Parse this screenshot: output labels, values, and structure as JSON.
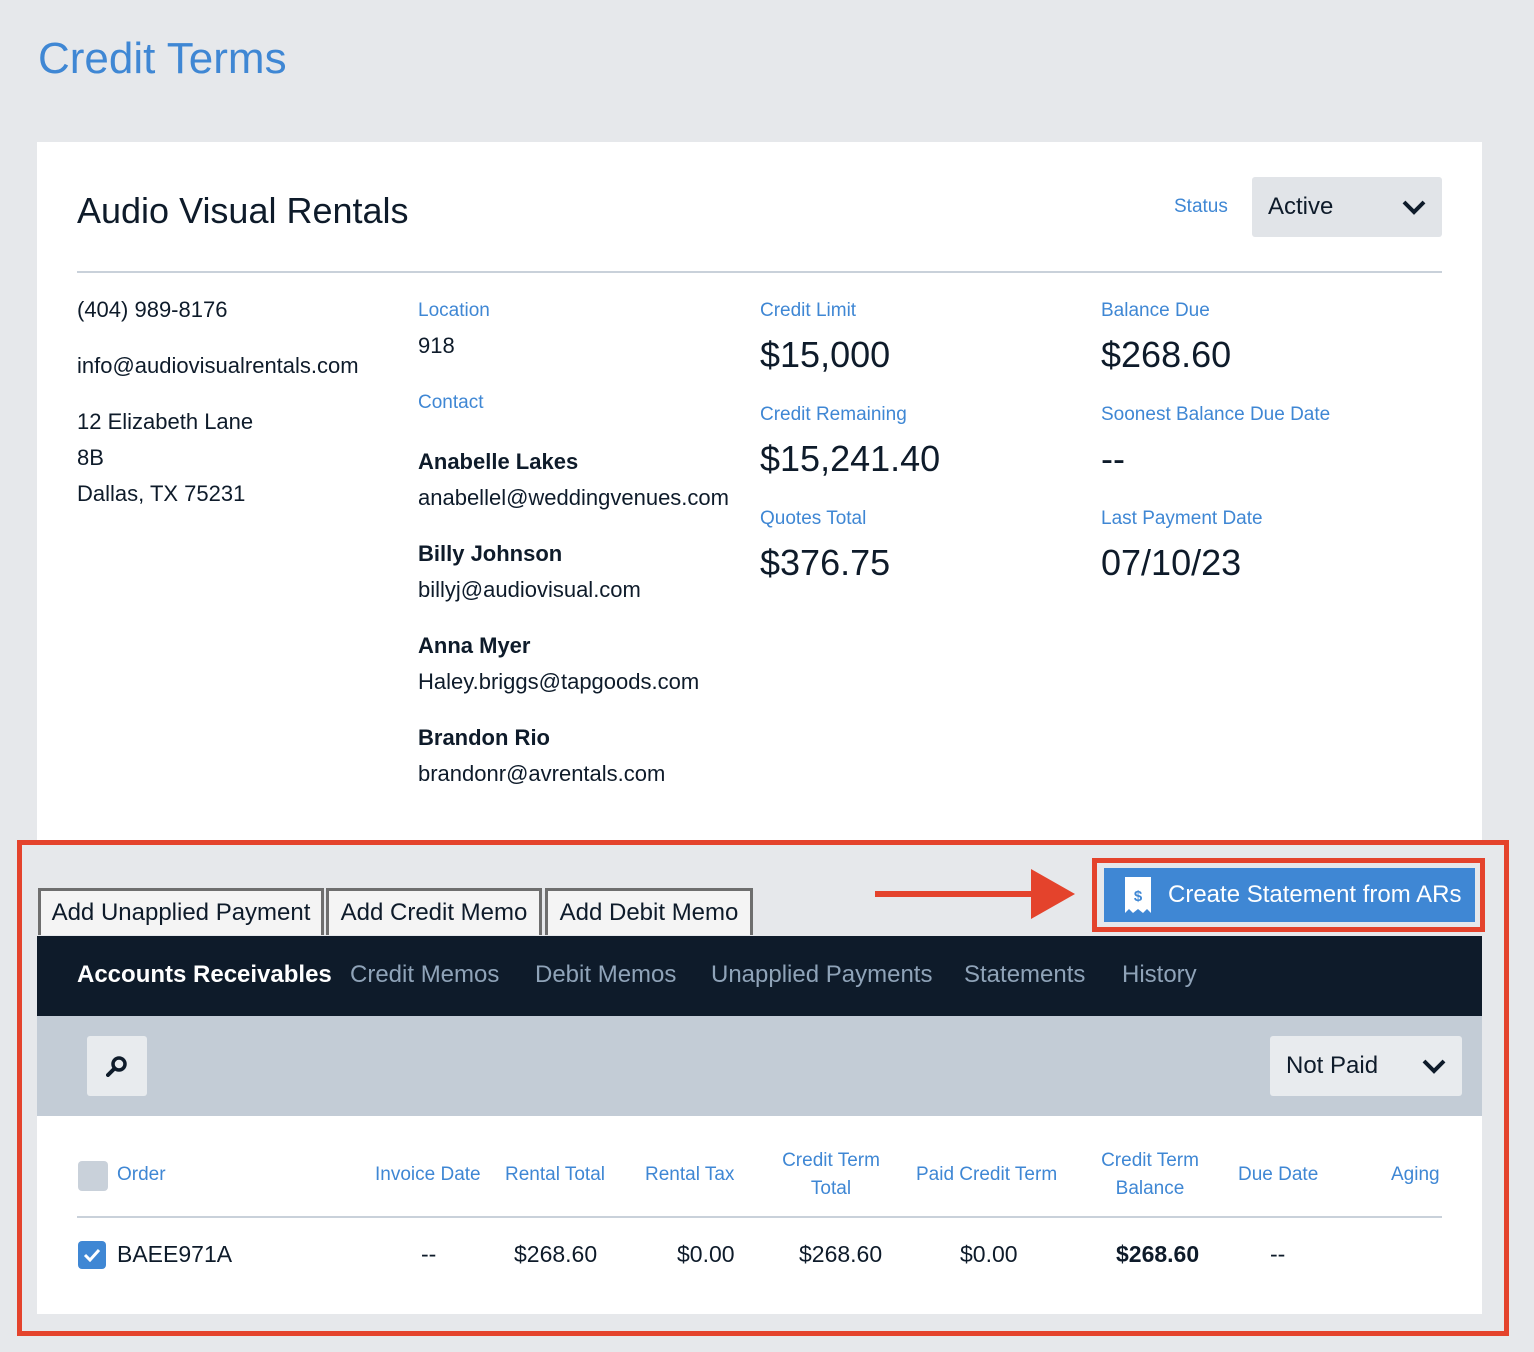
{
  "page_title": "Credit Terms",
  "company": {
    "name": "Audio Visual Rentals",
    "status_label": "Status",
    "status_value": "Active",
    "phone": "(404) 989-8176",
    "email": "info@audiovisualrentals.com",
    "address_line1": "12 Elizabeth Lane",
    "address_line2": "8B",
    "address_line3": "Dallas, TX 75231"
  },
  "location": {
    "label": "Location",
    "value": "918"
  },
  "contacts": {
    "label": "Contact",
    "items": [
      {
        "name": "Anabelle Lakes",
        "email": "anabellel@weddingvenues.com"
      },
      {
        "name": "Billy Johnson",
        "email": "billyj@audiovisual.com"
      },
      {
        "name": "Anna Myer",
        "email": "Haley.briggs@tapgoods.com"
      },
      {
        "name": "Brandon Rio",
        "email": "brandonr@avrentals.com"
      }
    ]
  },
  "credit": {
    "limit_label": "Credit Limit",
    "limit_value": "$15,000",
    "remaining_label": "Credit Remaining",
    "remaining_value": "$15,241.40",
    "quotes_label": "Quotes Total",
    "quotes_value": "$376.75",
    "balance_label": "Balance Due",
    "balance_value": "$268.60",
    "soonest_label": "Soonest Balance Due Date",
    "soonest_value": "--",
    "last_payment_label": "Last Payment Date",
    "last_payment_value": "07/10/23"
  },
  "actions": {
    "add_unapplied": "Add Unapplied Payment",
    "add_credit_memo": "Add Credit Memo",
    "add_debit_memo": "Add Debit Memo",
    "create_statement": "Create Statement from ARs"
  },
  "tabs": [
    "Accounts Receivables",
    "Credit Memos",
    "Debit Memos",
    "Unapplied Payments",
    "Statements",
    "History"
  ],
  "filter": {
    "selected": "Not Paid"
  },
  "table": {
    "headers": {
      "order": "Order",
      "invoice_date": "Invoice Date",
      "rental_total": "Rental Total",
      "rental_tax": "Rental Tax",
      "credit_term_total_1": "Credit Term",
      "credit_term_total_2": "Total",
      "paid_credit_term": "Paid Credit Term",
      "credit_term_balance_1": "Credit Term",
      "credit_term_balance_2": "Balance",
      "due_date": "Due Date",
      "aging": "Aging"
    },
    "rows": [
      {
        "order": "BAEE971A",
        "invoice_date": "--",
        "rental_total": "$268.60",
        "rental_tax": "$0.00",
        "credit_term_total": "$268.60",
        "paid_credit_term": "$0.00",
        "credit_term_balance": "$268.60",
        "due_date": "--",
        "aging": ""
      }
    ]
  },
  "colors": {
    "accent": "#3f87d4",
    "highlight": "#e4432c",
    "nav_bg": "#0e1b2a"
  }
}
